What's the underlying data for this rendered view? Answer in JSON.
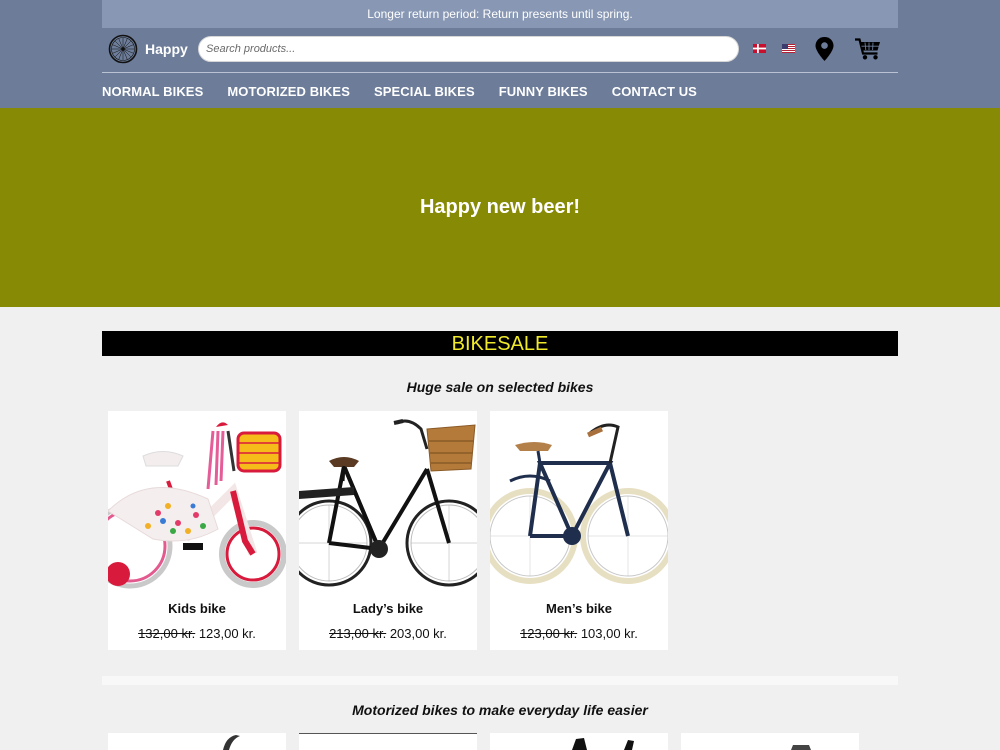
{
  "promo_bar": {
    "text": "Longer return period: Return presents until spring."
  },
  "header": {
    "brand": "Happy",
    "search_placeholder": "Search products...",
    "icons": {
      "logo": "bike-wheel-icon",
      "flag_dk": "danish-flag-icon",
      "flag_us": "us-flag-icon",
      "location": "map-pin-icon",
      "cart": "shopping-cart-icon"
    }
  },
  "nav": {
    "items": [
      {
        "label": "NORMAL BIKES"
      },
      {
        "label": "MOTORIZED BIKES"
      },
      {
        "label": "SPECIAL BIKES"
      },
      {
        "label": "FUNNY BIKES"
      },
      {
        "label": "CONTACT US"
      }
    ]
  },
  "hero": {
    "title": "Happy new beer!"
  },
  "sale": {
    "banner": "BIKESALE",
    "subtitle": "Huge sale on selected bikes",
    "products": [
      {
        "name": "Kids bike",
        "old_price": "132,00 kr.",
        "price": "123,00 kr."
      },
      {
        "name": "Lady’s bike",
        "old_price": "213,00 kr.",
        "price": "203,00 kr."
      },
      {
        "name": "Men’s bike",
        "old_price": "123,00 kr.",
        "price": "103,00 kr."
      }
    ]
  },
  "motorized": {
    "subtitle": "Motorized bikes to make everyday life easier"
  },
  "colors": {
    "header_bg": "#6c7c99",
    "promo_bg": "#8797b4",
    "hero_bg": "#878a04",
    "banner_bg": "#000000",
    "banner_text": "#f0ea2b",
    "page_bg": "#f0f0f0"
  }
}
